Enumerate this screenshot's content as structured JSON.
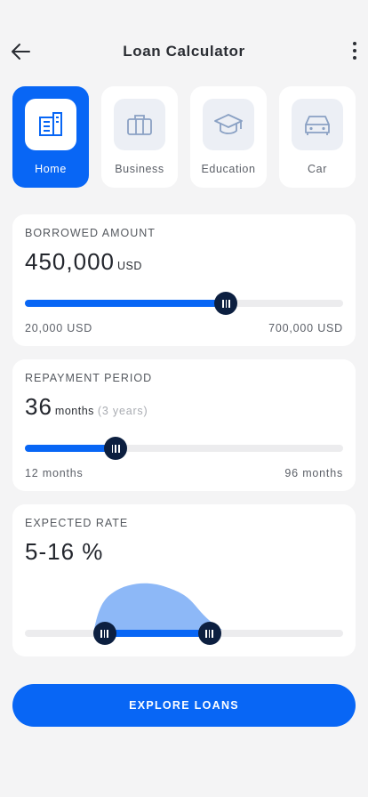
{
  "header": {
    "title": "Loan Calculator",
    "back_icon": "arrow-left-icon",
    "menu_icon": "more-vertical-icon"
  },
  "categories": [
    {
      "label": "Home",
      "icon": "building-icon",
      "active": true
    },
    {
      "label": "Business",
      "icon": "briefcase-icon",
      "active": false
    },
    {
      "label": "Education",
      "icon": "graduation-cap-icon",
      "active": false
    },
    {
      "label": "Car",
      "icon": "car-icon",
      "active": false
    }
  ],
  "borrowed": {
    "label": "BORROWED AMOUNT",
    "value": "450,000",
    "unit": "USD",
    "min_label": "20,000 USD",
    "max_label": "700,000 USD",
    "min": 20000,
    "max": 700000,
    "current": 450000
  },
  "period": {
    "label": "REPAYMENT PERIOD",
    "value": "36",
    "unit": "months",
    "sub": "(3 years)",
    "min_label": "12 months",
    "max_label": "96 months",
    "min": 12,
    "max": 96,
    "current": 36
  },
  "rate": {
    "label": "EXPECTED RATE",
    "value": "5-16 %",
    "range_low_fraction": 0.25,
    "range_high_fraction": 0.58
  },
  "cta": {
    "label": "EXPLORE LOANS"
  },
  "colors": {
    "accent": "#0866f5",
    "thumb": "#0c1f40",
    "distribution": "#8db8f7",
    "background": "#f4f4f5"
  }
}
